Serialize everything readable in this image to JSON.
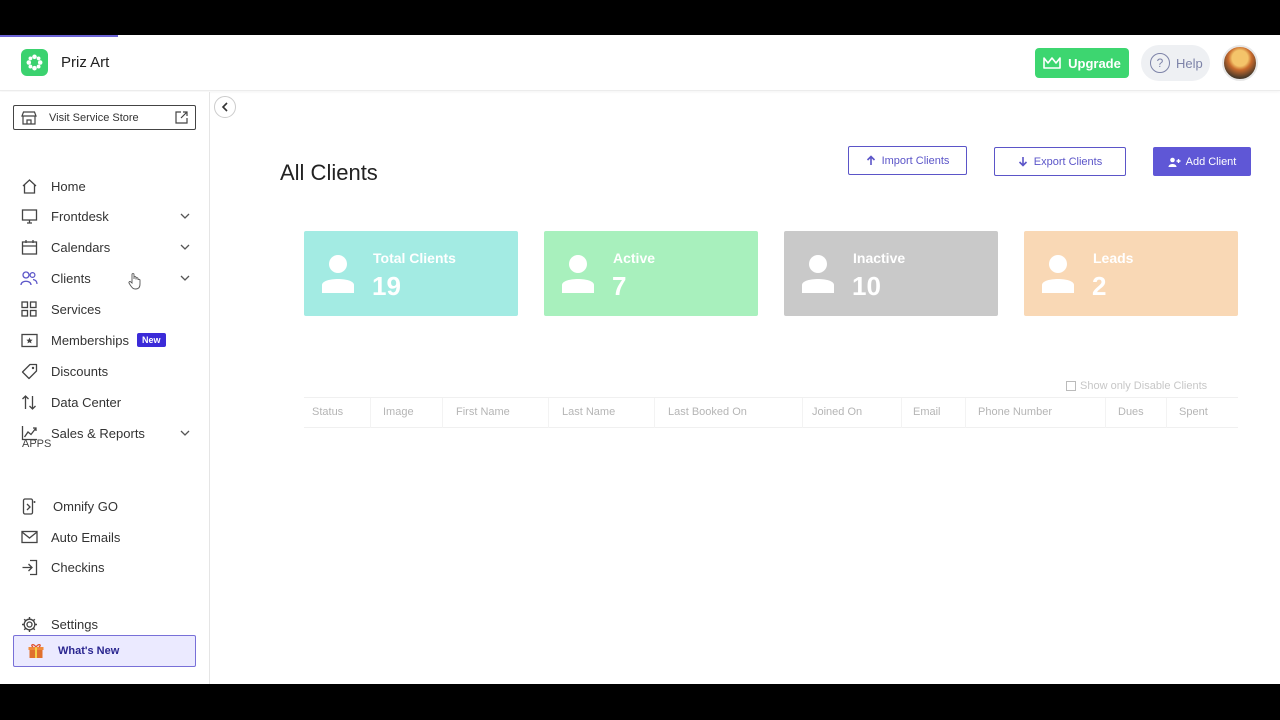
{
  "topbar": {
    "brand": "Priz Art",
    "upgrade_label": "Upgrade",
    "help_label": "Help"
  },
  "sidebar": {
    "store_label": "Visit Service Store",
    "items": [
      {
        "label": "Home",
        "icon": "home-icon"
      },
      {
        "label": "Frontdesk",
        "icon": "monitor-icon",
        "expandable": true
      },
      {
        "label": "Calendars",
        "icon": "calendar-icon",
        "expandable": true
      },
      {
        "label": "Clients",
        "icon": "users-icon",
        "expandable": true
      },
      {
        "label": "Services",
        "icon": "grid-icon"
      },
      {
        "label": "Memberships",
        "icon": "membership-card-icon",
        "badge": "New"
      },
      {
        "label": "Discounts",
        "icon": "tag-icon"
      },
      {
        "label": "Data Center",
        "icon": "sort-arrows-icon"
      },
      {
        "label": "Sales & Reports",
        "icon": "chart-icon",
        "expandable": true
      }
    ],
    "apps_heading": "APPS",
    "apps": [
      {
        "label": "Omnify GO",
        "icon": "phone-icon"
      },
      {
        "label": "Auto Emails",
        "icon": "mail-icon"
      },
      {
        "label": "Checkins",
        "icon": "checkin-icon"
      }
    ],
    "settings_label": "Settings",
    "whats_new_label": "What's New"
  },
  "main": {
    "title": "All Clients",
    "import_label": "Import Clients",
    "export_label": "Export Clients",
    "add_label": "Add Client",
    "stats": [
      {
        "label": "Total Clients",
        "value": "19",
        "color": "#a3ebe3"
      },
      {
        "label": "Active",
        "value": "7",
        "color": "#a8f0bd"
      },
      {
        "label": "Inactive",
        "value": "10",
        "color": "#c9c9c9"
      },
      {
        "label": "Leads",
        "value": "2",
        "color": "#f9d8b5"
      }
    ],
    "filter_label": "Show only Disable Clients",
    "columns": [
      "Status",
      "Image",
      "First Name",
      "Last Name",
      "Last Booked On",
      "Joined On",
      "Email",
      "Phone Number",
      "Dues",
      "Spent"
    ]
  },
  "colors": {
    "accent": "#5f57d6",
    "upgrade": "#3dd670"
  }
}
